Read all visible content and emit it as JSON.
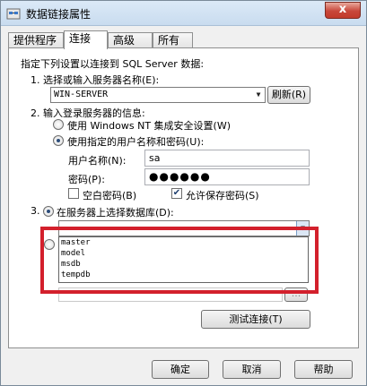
{
  "window": {
    "title": "数据链接属性",
    "close_label": "x"
  },
  "tabs": [
    {
      "label": "提供程序",
      "active": false
    },
    {
      "label": "连接",
      "active": true
    },
    {
      "label": "高级",
      "active": false
    },
    {
      "label": "所有",
      "active": false
    }
  ],
  "intro": "指定下列设置以连接到 SQL Server 数据:",
  "step1": {
    "label": "1. 选择或输入服务器名称(E):",
    "server_value": "WIN-SERVER",
    "refresh_label": "刷新(R)"
  },
  "step2": {
    "label": "2. 输入登录服务器的信息:",
    "option_nt": "使用 Windows NT 集成安全设置(W)",
    "option_user": "使用指定的用户名称和密码(U):",
    "username_label": "用户名称(N):",
    "username_value": "sa",
    "password_label": "密码(P):",
    "password_value": "●●●●●●",
    "blank_password": "空白密码(B)",
    "allow_save": "允许保存密码(S)"
  },
  "step3": {
    "label": "3.",
    "option_select_db": "在服务器上选择数据库(D):",
    "db_value": "",
    "db_options": [
      "master",
      "model",
      "msdb",
      "tempdb"
    ],
    "browse_label": "..."
  },
  "test_button": "测试连接(T)",
  "buttons": {
    "ok": "确定",
    "cancel": "取消",
    "help": "帮助"
  },
  "colors": {
    "highlight": "#d3202c",
    "title_bar": "#dbe9f7",
    "close": "#c8473a"
  }
}
